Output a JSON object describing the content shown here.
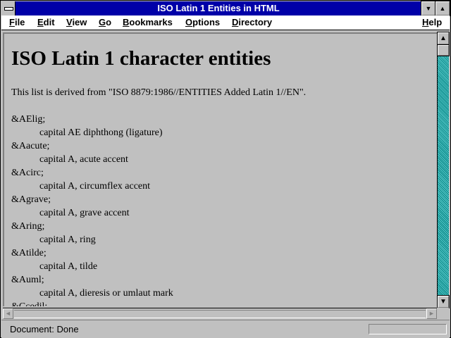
{
  "window": {
    "title": "ISO Latin 1 Entities in HTML",
    "minimize_glyph": "▼",
    "maximize_glyph": "▲"
  },
  "menubar": {
    "items": [
      {
        "label": "File",
        "mnemonic": "F",
        "rest": "ile"
      },
      {
        "label": "Edit",
        "mnemonic": "E",
        "rest": "dit"
      },
      {
        "label": "View",
        "mnemonic": "V",
        "rest": "iew"
      },
      {
        "label": "Go",
        "mnemonic": "G",
        "rest": "o"
      },
      {
        "label": "Bookmarks",
        "mnemonic": "B",
        "rest": "ookmarks"
      },
      {
        "label": "Options",
        "mnemonic": "O",
        "rest": "ptions"
      },
      {
        "label": "Directory",
        "mnemonic": "D",
        "rest": "irectory"
      },
      {
        "label": "Help",
        "mnemonic": "H",
        "rest": "elp"
      }
    ]
  },
  "document": {
    "heading": "ISO Latin 1 character entities",
    "intro": "This list is derived from \"ISO 8879:1986//ENTITIES Added Latin 1//EN\".",
    "entries": [
      {
        "term": "&AElig;",
        "definition": "capital AE diphthong (ligature)"
      },
      {
        "term": "&Aacute;",
        "definition": "capital A, acute accent"
      },
      {
        "term": "&Acirc;",
        "definition": "capital A, circumflex accent"
      },
      {
        "term": "&Agrave;",
        "definition": "capital A, grave accent"
      },
      {
        "term": "&Aring;",
        "definition": "capital A, ring"
      },
      {
        "term": "&Atilde;",
        "definition": "capital A, tilde"
      },
      {
        "term": "&Auml;",
        "definition": "capital A, dieresis or umlaut mark"
      },
      {
        "term": "&Ccedil;",
        "definition": ""
      }
    ]
  },
  "scrollbars": {
    "up_glyph": "▲",
    "down_glyph": "▼",
    "left_glyph": "◄",
    "right_glyph": "►"
  },
  "status": {
    "text": "Document: Done"
  }
}
